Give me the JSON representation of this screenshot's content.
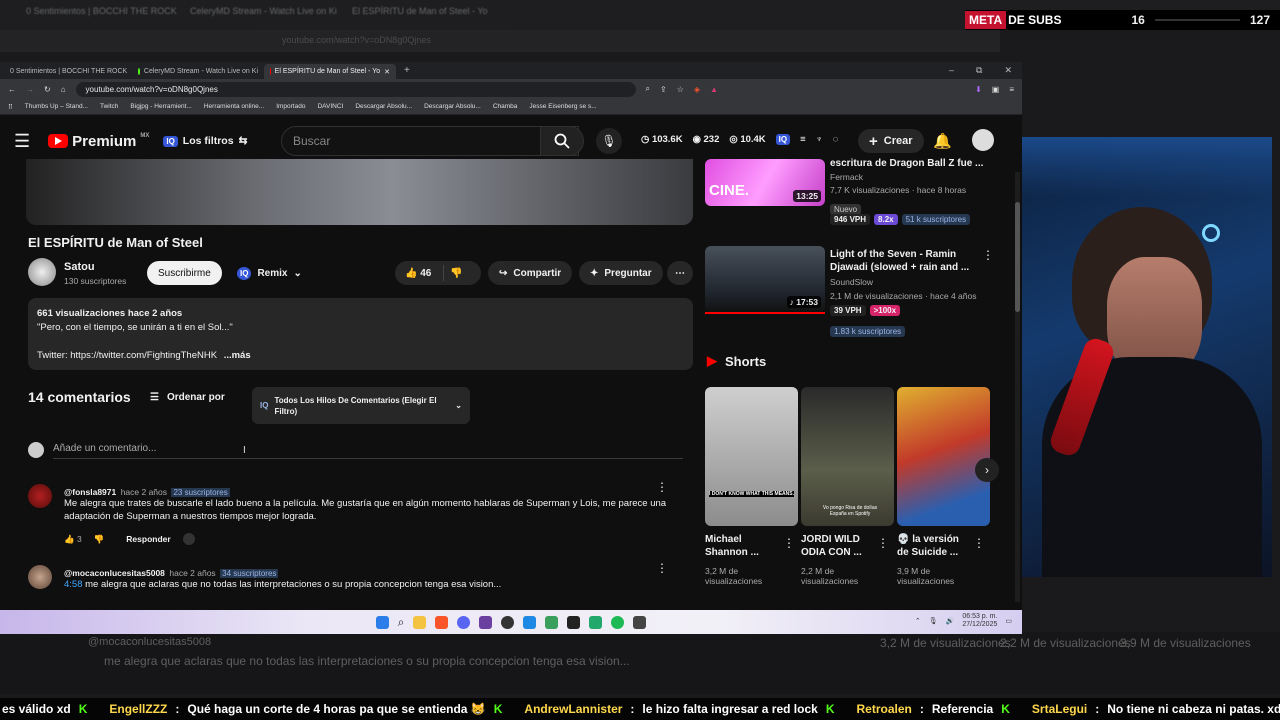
{
  "outer": {
    "tabs": [
      "0 Sentimientos | BOCCHI THE ROCK",
      "CeleryMD Stream - Watch Live on Ki",
      "El ESPÍRITU de Man of Steel - Yo"
    ],
    "url": "youtube.com/watch?v=oDN8g0Qjnes"
  },
  "meta": {
    "label": "META",
    "label2": "DE SUBS",
    "current": "16",
    "goal": "127"
  },
  "browser": {
    "tabs": [
      {
        "title": "0 Sentimientos | BOCCHI THE ROCK",
        "color": "#ff3b30"
      },
      {
        "title": "CeleryMD Stream - Watch Live on Ki",
        "color": "#53fc18"
      },
      {
        "title": "El ESPÍRITU de Man of Steel - Yo",
        "color": "#ff0000"
      }
    ],
    "url": "youtube.com/watch?v=oDN8g0Qjnes",
    "bookmarks": [
      "Thumbs Up – Stand...",
      "Twitch",
      "Bigjpg - Herramient...",
      "Herramienta online...",
      "Importado",
      "DAVINCI",
      "Descargar Absolu...",
      "Descargar Absolu...",
      "Chamba",
      "Jesse Eisenberg se s..."
    ]
  },
  "yt": {
    "premium": "Premium",
    "region": "MX",
    "filters": "Los filtros",
    "search_placeholder": "Buscar",
    "stats": {
      "views": "103.6K",
      "likes": "232",
      "subs": "10.4K"
    },
    "create": "Crear"
  },
  "video": {
    "title": "El ESPÍRITU de Man of Steel",
    "channel": "Satou",
    "subscribers": "130 suscriptores",
    "subscribe": "Suscribirme",
    "remix": "Remix",
    "likes": "46",
    "share": "Compartir",
    "ask": "Preguntar",
    "desc_meta": "661 visualizaciones  hace 2 años",
    "desc_line1": "\"Pero, con el tiempo, se unirán a ti en el Sol...\"",
    "desc_line2": "Twitter: https://twitter.com/FightingTheNHK",
    "more": "...más"
  },
  "comments": {
    "count": "14 comentarios",
    "sort": "Ordenar por",
    "filter": "Todos Los Hilos De Comentarios (Elegir El Filtro)",
    "add": "Añade un comentario...",
    "items": [
      {
        "handle": "@fonsla8971",
        "time": "hace 2 años",
        "subs": "23 suscriptores",
        "text": "Me alegra que trates de buscarle el lado bueno a la película. Me gustaría que en algún momento hablaras de Superman y Lois, me parece una adaptación de Superman a nuestros tiempos mejor lograda.",
        "likes": "3",
        "reply": "Responder"
      },
      {
        "handle": "@mocaconlucesitas5008",
        "time": "hace 2 años",
        "subs": "34 suscriptores",
        "timestamp": "4:58",
        "text": "me alegra que aclaras que no todas las interpretaciones o su propia concepcion tenga esa vision..."
      }
    ]
  },
  "related": [
    {
      "title": "escritura de Dragon Ball Z fue ...",
      "channel": "Fermack",
      "meta": "7,7 K visualizaciones · hace 8 horas",
      "badge": "Nuevo",
      "vph": "946 VPH",
      "mult": "8.2x",
      "subs": "51 k suscriptores",
      "duration": "13:25",
      "thumb_text": "CINE."
    },
    {
      "title": "Light of the Seven - Ramin Djawadi (slowed + rain and ...",
      "channel": "SoundSlow",
      "meta": "2,1 M de visualizaciones · hace 4 años",
      "vph": "39 VPH",
      "mult": ">100x",
      "subs": "1.83 k suscriptores",
      "duration": "17:53"
    }
  ],
  "shorts": {
    "label": "Shorts",
    "items": [
      {
        "title": "Michael Shannon ...",
        "views": "3,2 M de visualizaciones",
        "caption": "I DON'T KNOW WHAT THIS MEANS."
      },
      {
        "title": "JORDI WILD ODIA CON ...",
        "views": "2,2 M de visualizaciones",
        "caption": "Vo pongo Risa de dolías España en Spotify"
      },
      {
        "title": "💀 la versión de Suicide ...",
        "views": "3,9 M de visualizaciones",
        "caption": ""
      }
    ]
  },
  "taskbar": {
    "time": "06:53 p. m.",
    "date": "27/12/2025"
  },
  "chat": [
    {
      "user": "",
      "text": "es válido xd"
    },
    {
      "user": "EngellZZZ",
      "text": "Qué haga un corte de 4 horas pa que se entienda 😸"
    },
    {
      "user": "AndrewLannister",
      "text": "le hizo falta ingresar a red lock"
    },
    {
      "user": "Retroalen",
      "text": "Referencia"
    },
    {
      "user": "SrtaLegui",
      "text": "No tiene ni cabeza ni patas. xd"
    }
  ],
  "colors": {
    "accent": "#3ea6ff",
    "kick": "#53fc18",
    "yt_red": "#ff0000",
    "meta_red": "#c4122f"
  }
}
